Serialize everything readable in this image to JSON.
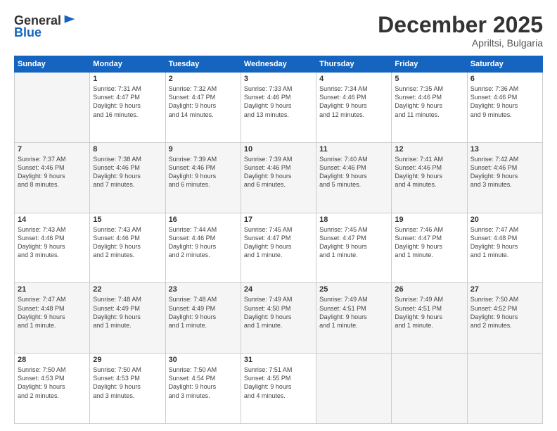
{
  "logo": {
    "general": "General",
    "blue": "Blue"
  },
  "title": "December 2025",
  "subtitle": "Apriltsi, Bulgaria",
  "days": [
    "Sunday",
    "Monday",
    "Tuesday",
    "Wednesday",
    "Thursday",
    "Friday",
    "Saturday"
  ],
  "weeks": [
    [
      {
        "num": "",
        "info": ""
      },
      {
        "num": "1",
        "info": "Sunrise: 7:31 AM\nSunset: 4:47 PM\nDaylight: 9 hours\nand 16 minutes."
      },
      {
        "num": "2",
        "info": "Sunrise: 7:32 AM\nSunset: 4:47 PM\nDaylight: 9 hours\nand 14 minutes."
      },
      {
        "num": "3",
        "info": "Sunrise: 7:33 AM\nSunset: 4:46 PM\nDaylight: 9 hours\nand 13 minutes."
      },
      {
        "num": "4",
        "info": "Sunrise: 7:34 AM\nSunset: 4:46 PM\nDaylight: 9 hours\nand 12 minutes."
      },
      {
        "num": "5",
        "info": "Sunrise: 7:35 AM\nSunset: 4:46 PM\nDaylight: 9 hours\nand 11 minutes."
      },
      {
        "num": "6",
        "info": "Sunrise: 7:36 AM\nSunset: 4:46 PM\nDaylight: 9 hours\nand 9 minutes."
      }
    ],
    [
      {
        "num": "7",
        "info": "Sunrise: 7:37 AM\nSunset: 4:46 PM\nDaylight: 9 hours\nand 8 minutes."
      },
      {
        "num": "8",
        "info": "Sunrise: 7:38 AM\nSunset: 4:46 PM\nDaylight: 9 hours\nand 7 minutes."
      },
      {
        "num": "9",
        "info": "Sunrise: 7:39 AM\nSunset: 4:46 PM\nDaylight: 9 hours\nand 6 minutes."
      },
      {
        "num": "10",
        "info": "Sunrise: 7:39 AM\nSunset: 4:46 PM\nDaylight: 9 hours\nand 6 minutes."
      },
      {
        "num": "11",
        "info": "Sunrise: 7:40 AM\nSunset: 4:46 PM\nDaylight: 9 hours\nand 5 minutes."
      },
      {
        "num": "12",
        "info": "Sunrise: 7:41 AM\nSunset: 4:46 PM\nDaylight: 9 hours\nand 4 minutes."
      },
      {
        "num": "13",
        "info": "Sunrise: 7:42 AM\nSunset: 4:46 PM\nDaylight: 9 hours\nand 3 minutes."
      }
    ],
    [
      {
        "num": "14",
        "info": "Sunrise: 7:43 AM\nSunset: 4:46 PM\nDaylight: 9 hours\nand 3 minutes."
      },
      {
        "num": "15",
        "info": "Sunrise: 7:43 AM\nSunset: 4:46 PM\nDaylight: 9 hours\nand 2 minutes."
      },
      {
        "num": "16",
        "info": "Sunrise: 7:44 AM\nSunset: 4:46 PM\nDaylight: 9 hours\nand 2 minutes."
      },
      {
        "num": "17",
        "info": "Sunrise: 7:45 AM\nSunset: 4:47 PM\nDaylight: 9 hours\nand 1 minute."
      },
      {
        "num": "18",
        "info": "Sunrise: 7:45 AM\nSunset: 4:47 PM\nDaylight: 9 hours\nand 1 minute."
      },
      {
        "num": "19",
        "info": "Sunrise: 7:46 AM\nSunset: 4:47 PM\nDaylight: 9 hours\nand 1 minute."
      },
      {
        "num": "20",
        "info": "Sunrise: 7:47 AM\nSunset: 4:48 PM\nDaylight: 9 hours\nand 1 minute."
      }
    ],
    [
      {
        "num": "21",
        "info": "Sunrise: 7:47 AM\nSunset: 4:48 PM\nDaylight: 9 hours\nand 1 minute."
      },
      {
        "num": "22",
        "info": "Sunrise: 7:48 AM\nSunset: 4:49 PM\nDaylight: 9 hours\nand 1 minute."
      },
      {
        "num": "23",
        "info": "Sunrise: 7:48 AM\nSunset: 4:49 PM\nDaylight: 9 hours\nand 1 minute."
      },
      {
        "num": "24",
        "info": "Sunrise: 7:49 AM\nSunset: 4:50 PM\nDaylight: 9 hours\nand 1 minute."
      },
      {
        "num": "25",
        "info": "Sunrise: 7:49 AM\nSunset: 4:51 PM\nDaylight: 9 hours\nand 1 minute."
      },
      {
        "num": "26",
        "info": "Sunrise: 7:49 AM\nSunset: 4:51 PM\nDaylight: 9 hours\nand 1 minute."
      },
      {
        "num": "27",
        "info": "Sunrise: 7:50 AM\nSunset: 4:52 PM\nDaylight: 9 hours\nand 2 minutes."
      }
    ],
    [
      {
        "num": "28",
        "info": "Sunrise: 7:50 AM\nSunset: 4:53 PM\nDaylight: 9 hours\nand 2 minutes."
      },
      {
        "num": "29",
        "info": "Sunrise: 7:50 AM\nSunset: 4:53 PM\nDaylight: 9 hours\nand 3 minutes."
      },
      {
        "num": "30",
        "info": "Sunrise: 7:50 AM\nSunset: 4:54 PM\nDaylight: 9 hours\nand 3 minutes."
      },
      {
        "num": "31",
        "info": "Sunrise: 7:51 AM\nSunset: 4:55 PM\nDaylight: 9 hours\nand 4 minutes."
      },
      {
        "num": "",
        "info": ""
      },
      {
        "num": "",
        "info": ""
      },
      {
        "num": "",
        "info": ""
      }
    ]
  ]
}
